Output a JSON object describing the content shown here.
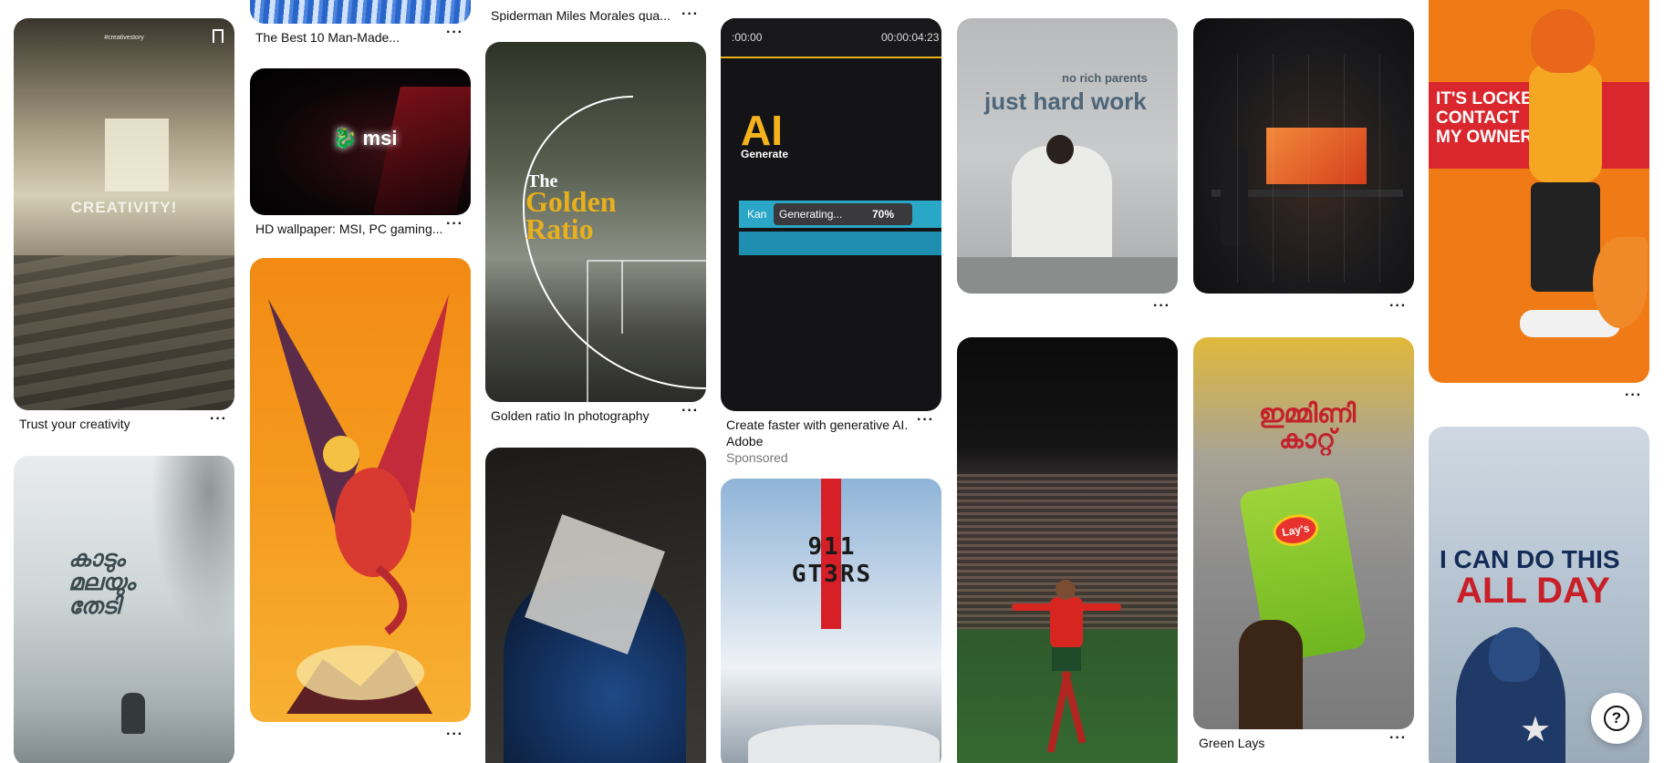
{
  "pins": {
    "trust": {
      "title": "Trust your creativity",
      "overlay": "CREATIVITY!",
      "tag": "#creativestory"
    },
    "kadum": {
      "overlay": "കാടും മലയും തേടി"
    },
    "manmade": {
      "title": "The Best 10 Man-Made..."
    },
    "msi": {
      "title": "HD wallpaper: MSI, PC gaming...",
      "logo": "msi"
    },
    "spiderman": {
      "title": "Spiderman Miles Morales qua..."
    },
    "golden": {
      "title": "Golden ratio In photography",
      "overlay_line1": "The",
      "overlay_line2": "Golden",
      "overlay_line3": "Ratio"
    },
    "adobe": {
      "title": "Create faster with generative AI.",
      "advertiser": "Adobe",
      "sponsored": "Sponsored",
      "overlay_ai": "AI",
      "overlay_generate": "Generate",
      "time_start": ":00:00",
      "time_end": "00:00:04:23",
      "bar_text": "Generating...",
      "bar_left": "Kan",
      "progress": "70%"
    },
    "gt3": {
      "overlay": "911 GT3RS"
    },
    "hardwork": {
      "overlay_small": "no rich parents",
      "overlay_big": "just hard work"
    },
    "lays": {
      "title": "Green Lays",
      "brand": "Lay's"
    },
    "fox": {
      "overlay": "IT'S LOCKED CONTACT MY OWNER"
    },
    "captain": {
      "overlay_line1": "I CAN DO THIS",
      "overlay_line2": "ALL DAY"
    }
  },
  "more_label": "···",
  "help_label": "?",
  "colors": {
    "accent_red": "#d61f26",
    "gold": "#e7b01c",
    "orange": "#f07b16"
  }
}
